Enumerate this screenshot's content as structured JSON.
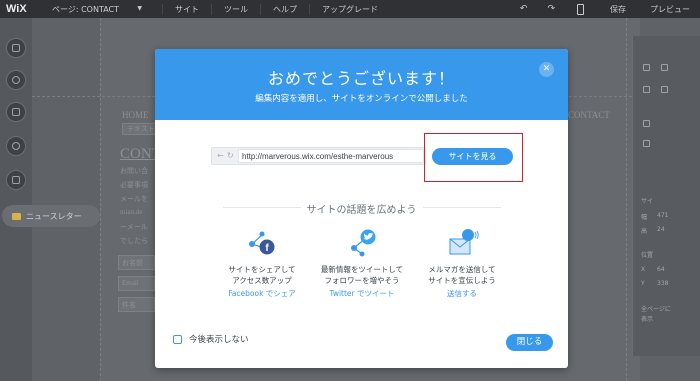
{
  "editor": {
    "logo": "WiX",
    "page_selector": "ページ: CONTACT",
    "menu": [
      "サイト",
      "ツール",
      "ヘルプ",
      "アップグレード"
    ],
    "save_label": "保存",
    "preview_label": "プレビュー",
    "newsletter_label": "ニュースレター",
    "canvas": {
      "nav_home": "HOME",
      "nav_contact": "CONTACT",
      "textbox_label": "テキスト",
      "heading": "CONT",
      "lines": [
        "お問い合",
        "必要事項",
        "メールを",
        "mian.de",
        "ーメール",
        "でしたら"
      ],
      "field_name": "お名前",
      "field_email": "Email",
      "field_subject": "件名"
    },
    "rightpanel": [
      "サイ",
      "幅",
      "高",
      "位置",
      "X",
      "Y",
      "全ページに",
      "表示"
    ],
    "rightpanel_values": [
      "471",
      "24",
      "64",
      "338"
    ]
  },
  "modal": {
    "title": "おめでとうございます！",
    "subtitle": "編集内容を適用し、サイトをオンラインで公開しました",
    "url": "http://marverous.wix.com/esthe-marverous",
    "view_site_label": "サイトを見る",
    "section_title": "サイトの話題を広めよう",
    "share": [
      {
        "icon": "facebook-share-icon",
        "desc": "サイトをシェアして\nアクセス数アップ",
        "link": "Facebook でシェア"
      },
      {
        "icon": "twitter-share-icon",
        "desc": "最新情報をツイートして\nフォロワーを増やそう",
        "link": "Twitter でツイート"
      },
      {
        "icon": "newsletter-share-icon",
        "desc": "メルマガを送信して\nサイトを宣伝しよう",
        "link": "送信する"
      }
    ],
    "dont_show_label": "今後表示しない",
    "close_label": "閉じる"
  },
  "colors": {
    "accent": "#3899ec",
    "facebook": "#3b5998",
    "twitter": "#3aa5ee",
    "highlight": "#d5202e"
  }
}
